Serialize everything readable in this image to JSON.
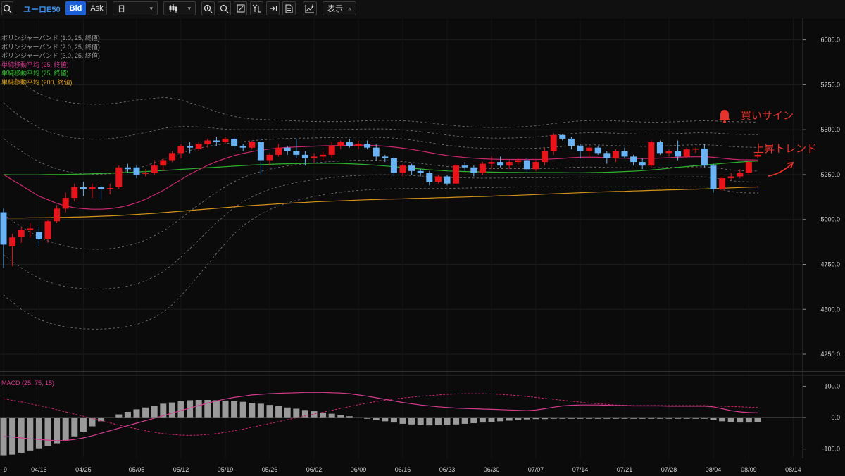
{
  "toolbar": {
    "symbol": "ユーロE50",
    "bid_label": "Bid",
    "ask_label": "Ask",
    "period_value": "日",
    "display_label": "表示"
  },
  "legend": {
    "bb1": "ボリンジャーバンド (1.0, 25, 終値)",
    "bb2": "ボリンジャーバンド (2.0, 25, 終値)",
    "bb3": "ボリンジャーバンド (3.0, 25, 終値)",
    "sma25": "単純移動平均 (25, 終値)",
    "sma75": "単純移動平均 (75, 終値)",
    "sma200": "単純移動平均 (200, 終値)"
  },
  "macd_label": "MACD (25, 75, 15)",
  "annotations": {
    "buy_signal": "買いサイン",
    "uptrend": "上昇トレンド"
  },
  "colors": {
    "up_candle": "#e8141c",
    "down_candle": "#6ab4f5",
    "sma25": "#c8286e",
    "sma75": "#2fb12f",
    "sma200": "#d4921c",
    "annotation": "#e8322c",
    "bid_active": "#1c5fd6"
  },
  "price_axis": {
    "ticks": [
      4250,
      4500,
      4750,
      5000,
      5250,
      5500,
      5750,
      6000
    ],
    "labels": [
      "4250.0",
      "4500.0",
      "4750.0",
      "5000.0",
      "5250.0",
      "5500.0",
      "5750.0",
      "6000.0"
    ]
  },
  "macd_axis": {
    "ticks": [
      -100,
      0,
      100
    ],
    "labels": [
      "-100.0",
      "0.0",
      "100.0"
    ]
  },
  "date_axis": {
    "labels": [
      "9",
      "04/16",
      "04/25",
      "05/05",
      "05/12",
      "05/19",
      "05/26",
      "06/02",
      "06/09",
      "06/16",
      "06/23",
      "06/30",
      "07/07",
      "07/14",
      "07/21",
      "07/28",
      "08/04",
      "08/09",
      "08/14"
    ],
    "index": [
      0,
      4,
      9,
      15,
      20,
      25,
      30,
      35,
      40,
      45,
      50,
      55,
      60,
      65,
      70,
      75,
      80,
      84,
      89
    ]
  },
  "chart_data": {
    "type": "candlestick",
    "candles": [
      [
        5040,
        5060,
        4730,
        4860
      ],
      [
        4850,
        4920,
        4740,
        4900
      ],
      [
        4905,
        4960,
        4870,
        4940
      ],
      [
        4940,
        4980,
        4900,
        4950
      ],
      [
        4930,
        4960,
        4850,
        4890
      ],
      [
        4890,
        5000,
        4870,
        4990
      ],
      [
        4990,
        5080,
        4980,
        5060
      ],
      [
        5060,
        5150,
        5040,
        5120
      ],
      [
        5120,
        5200,
        5100,
        5180
      ],
      [
        5180,
        5210,
        5130,
        5170
      ],
      [
        5170,
        5200,
        5120,
        5180
      ],
      [
        5180,
        5190,
        5110,
        5170
      ],
      [
        5170,
        5200,
        5140,
        5175
      ],
      [
        5180,
        5300,
        5170,
        5290
      ],
      [
        5290,
        5310,
        5260,
        5280
      ],
      [
        5290,
        5300,
        5230,
        5250
      ],
      [
        5260,
        5280,
        5240,
        5260
      ],
      [
        5260,
        5330,
        5250,
        5300
      ],
      [
        5300,
        5340,
        5270,
        5330
      ],
      [
        5330,
        5380,
        5320,
        5370
      ],
      [
        5370,
        5420,
        5340,
        5410
      ],
      [
        5410,
        5430,
        5370,
        5400
      ],
      [
        5395,
        5430,
        5380,
        5420
      ],
      [
        5420,
        5450,
        5400,
        5440
      ],
      [
        5440,
        5460,
        5410,
        5430
      ],
      [
        5430,
        5460,
        5420,
        5450
      ],
      [
        5450,
        5460,
        5390,
        5410
      ],
      [
        5410,
        5420,
        5380,
        5400
      ],
      [
        5400,
        5440,
        5390,
        5430
      ],
      [
        5430,
        5450,
        5250,
        5330
      ],
      [
        5330,
        5370,
        5300,
        5360
      ],
      [
        5360,
        5420,
        5350,
        5400
      ],
      [
        5400,
        5410,
        5360,
        5380
      ],
      [
        5380,
        5450,
        5340,
        5360
      ],
      [
        5360,
        5380,
        5300,
        5340
      ],
      [
        5340,
        5370,
        5310,
        5350
      ],
      [
        5350,
        5380,
        5330,
        5360
      ],
      [
        5360,
        5430,
        5340,
        5410
      ],
      [
        5410,
        5440,
        5390,
        5430
      ],
      [
        5430,
        5450,
        5400,
        5410
      ],
      [
        5410,
        5440,
        5390,
        5420
      ],
      [
        5420,
        5440,
        5390,
        5400
      ],
      [
        5400,
        5420,
        5330,
        5350
      ],
      [
        5350,
        5360,
        5320,
        5340
      ],
      [
        5340,
        5350,
        5240,
        5260
      ],
      [
        5260,
        5310,
        5240,
        5300
      ],
      [
        5300,
        5310,
        5250,
        5270
      ],
      [
        5270,
        5280,
        5240,
        5260
      ],
      [
        5260,
        5270,
        5190,
        5210
      ],
      [
        5210,
        5250,
        5200,
        5240
      ],
      [
        5240,
        5250,
        5190,
        5200
      ],
      [
        5200,
        5310,
        5195,
        5300
      ],
      [
        5300,
        5320,
        5270,
        5290
      ],
      [
        5290,
        5300,
        5240,
        5260
      ],
      [
        5260,
        5320,
        5250,
        5310
      ],
      [
        5310,
        5350,
        5280,
        5320
      ],
      [
        5320,
        5350,
        5290,
        5300
      ],
      [
        5300,
        5330,
        5280,
        5320
      ],
      [
        5320,
        5340,
        5300,
        5330
      ],
      [
        5330,
        5340,
        5260,
        5280
      ],
      [
        5280,
        5330,
        5270,
        5320
      ],
      [
        5320,
        5400,
        5300,
        5380
      ],
      [
        5380,
        5480,
        5360,
        5470
      ],
      [
        5470,
        5475,
        5440,
        5450
      ],
      [
        5450,
        5460,
        5390,
        5410
      ],
      [
        5410,
        5420,
        5340,
        5380
      ],
      [
        5380,
        5410,
        5350,
        5400
      ],
      [
        5400,
        5410,
        5360,
        5370
      ],
      [
        5370,
        5380,
        5310,
        5340
      ],
      [
        5340,
        5390,
        5320,
        5380
      ],
      [
        5380,
        5400,
        5340,
        5350
      ],
      [
        5350,
        5360,
        5300,
        5320
      ],
      [
        5320,
        5340,
        5280,
        5300
      ],
      [
        5300,
        5440,
        5290,
        5430
      ],
      [
        5430,
        5440,
        5360,
        5370
      ],
      [
        5370,
        5390,
        5350,
        5380
      ],
      [
        5380,
        5440,
        5330,
        5350
      ],
      [
        5350,
        5400,
        5340,
        5390
      ],
      [
        5390,
        5400,
        5370,
        5395
      ],
      [
        5395,
        5420,
        5290,
        5300
      ],
      [
        5300,
        5310,
        5150,
        5170
      ],
      [
        5170,
        5240,
        5160,
        5230
      ],
      [
        5230,
        5260,
        5220,
        5240
      ],
      [
        5240,
        5280,
        5230,
        5260
      ],
      [
        5260,
        5330,
        5250,
        5320
      ],
      [
        5350,
        5370,
        5340,
        5360
      ]
    ],
    "sma25": [
      5250,
      5220,
      5190,
      5160,
      5130,
      5110,
      5090,
      5075,
      5065,
      5060,
      5057,
      5057,
      5060,
      5067,
      5078,
      5093,
      5112,
      5137,
      5162,
      5192,
      5222,
      5252,
      5277,
      5302,
      5322,
      5340,
      5356,
      5368,
      5378,
      5386,
      5392,
      5397,
      5401,
      5404,
      5406,
      5408,
      5410,
      5411,
      5412,
      5413,
      5414,
      5413,
      5411,
      5408,
      5403,
      5397,
      5390,
      5382,
      5373,
      5364,
      5356,
      5350,
      5345,
      5341,
      5338,
      5336,
      5335,
      5334,
      5334,
      5334,
      5334,
      5335,
      5337,
      5340,
      5344,
      5346,
      5347,
      5346,
      5344,
      5342,
      5341,
      5340,
      5339,
      5340,
      5342,
      5344,
      5346,
      5348,
      5349,
      5349,
      5346,
      5341,
      5336,
      5333,
      5332,
      5331
    ],
    "sma75": [
      5250,
      5249,
      5249,
      5249,
      5249,
      5250,
      5250,
      5251,
      5252,
      5253,
      5255,
      5256,
      5258,
      5260,
      5262,
      5265,
      5267,
      5270,
      5273,
      5276,
      5279,
      5282,
      5285,
      5288,
      5291,
      5294,
      5297,
      5300,
      5303,
      5305,
      5307,
      5309,
      5310,
      5311,
      5312,
      5313,
      5313,
      5313,
      5312,
      5310,
      5308,
      5305,
      5302,
      5298,
      5294,
      5290,
      5285,
      5281,
      5277,
      5274,
      5271,
      5269,
      5267,
      5266,
      5265,
      5264,
      5263,
      5262,
      5262,
      5261,
      5261,
      5261,
      5261,
      5261,
      5260,
      5260,
      5261,
      5262,
      5263,
      5265,
      5267,
      5269,
      5272,
      5276,
      5280,
      5285,
      5290,
      5295,
      5299,
      5303,
      5307,
      5312,
      5316,
      5320,
      5323,
      5325
    ],
    "sma200": [
      5008,
      5008,
      5008,
      5009,
      5009,
      5010,
      5011,
      5012,
      5013,
      5014,
      5016,
      5018,
      5020,
      5022,
      5025,
      5028,
      5031,
      5034,
      5038,
      5042,
      5046,
      5050,
      5054,
      5058,
      5062,
      5066,
      5070,
      5074,
      5078,
      5081,
      5084,
      5087,
      5090,
      5093,
      5095,
      5098,
      5100,
      5102,
      5104,
      5106,
      5108,
      5110,
      5111,
      5113,
      5114,
      5115,
      5117,
      5118,
      5119,
      5121,
      5122,
      5124,
      5125,
      5127,
      5128,
      5130,
      5132,
      5133,
      5135,
      5137,
      5139,
      5141,
      5143,
      5145,
      5147,
      5149,
      5151,
      5153,
      5154,
      5156,
      5157,
      5159,
      5160,
      5162,
      5163,
      5165,
      5166,
      5168,
      5169,
      5170,
      5172,
      5174,
      5176,
      5178,
      5180,
      5181
    ],
    "bb_upper3": [
      5850,
      5800,
      5760,
      5730,
      5700,
      5680,
      5665,
      5655,
      5648,
      5644,
      5642,
      5642,
      5645,
      5650,
      5657,
      5665,
      5670,
      5675,
      5680,
      5675,
      5665,
      5650,
      5635,
      5618,
      5600,
      5585,
      5573,
      5565,
      5560,
      5557,
      5555,
      5553,
      5551,
      5549,
      5547,
      5546,
      5545,
      5545,
      5545,
      5546,
      5548,
      5550,
      5551,
      5552,
      5551,
      5550,
      5547,
      5543,
      5538,
      5532,
      5527,
      5522,
      5518,
      5515,
      5513,
      5512,
      5512,
      5513,
      5515,
      5518,
      5522,
      5528,
      5534,
      5540,
      5545,
      5549,
      5551,
      5552,
      5551,
      5549,
      5547,
      5545,
      5543,
      5542,
      5542,
      5543,
      5545,
      5547,
      5549,
      5550,
      5549,
      5547,
      5545,
      5544,
      5543,
      5542
    ],
    "bb_lower3": [
      4580,
      4540,
      4500,
      4470,
      4445,
      4425,
      4412,
      4402,
      4396,
      4392,
      4390,
      4390,
      4393,
      4398,
      4405,
      4415,
      4432,
      4455,
      4485,
      4525,
      4575,
      4630,
      4690,
      4750,
      4810,
      4868,
      4920,
      4965,
      5000,
      5030,
      5055,
      5075,
      5092,
      5106,
      5118,
      5128,
      5137,
      5145,
      5152,
      5158,
      5162,
      5165,
      5168,
      5170,
      5171,
      5172,
      5172,
      5172,
      5172,
      5172,
      5173,
      5174,
      5175,
      5176,
      5177,
      5178,
      5179,
      5180,
      5181,
      5182,
      5182,
      5182,
      5182,
      5182,
      5182,
      5182,
      5182,
      5182,
      5182,
      5182,
      5182,
      5182,
      5182,
      5182,
      5182,
      5182,
      5182,
      5182,
      5182,
      5182,
      5176,
      5166,
      5156,
      5150,
      5148,
      5148
    ],
    "macd": [
      -60,
      -62,
      -65,
      -68,
      -70,
      -72,
      -74,
      -73,
      -70,
      -65,
      -58,
      -50,
      -42,
      -34,
      -26,
      -18,
      -10,
      -2,
      6,
      14,
      22,
      30,
      38,
      46,
      53,
      59,
      64,
      68,
      72,
      74,
      76,
      77,
      78,
      79,
      80,
      80,
      80,
      79,
      78,
      76,
      72,
      68,
      63,
      58,
      53,
      48,
      44,
      40,
      37,
      34,
      32,
      30,
      29,
      28,
      27,
      26,
      25,
      24,
      23,
      22,
      24,
      28,
      33,
      37,
      39,
      40,
      40,
      40,
      39,
      38,
      38,
      37,
      37,
      37,
      37,
      36,
      36,
      36,
      36,
      36,
      34,
      28,
      22,
      18,
      16,
      15
    ],
    "signal": [
      60,
      55,
      50,
      44,
      38,
      32,
      25,
      18,
      11,
      4,
      -3,
      -10,
      -17,
      -24,
      -30,
      -36,
      -42,
      -47,
      -51,
      -54,
      -56,
      -57,
      -56,
      -54,
      -51,
      -47,
      -42,
      -37,
      -31,
      -25,
      -19,
      -13,
      -7,
      -1,
      5,
      11,
      17,
      23,
      29,
      35,
      41,
      46,
      51,
      55,
      59,
      62,
      65,
      68,
      70,
      72,
      74,
      75,
      76,
      76,
      76,
      75,
      74,
      72,
      70,
      67,
      64,
      61,
      58,
      55,
      52,
      49,
      46,
      44,
      42,
      40,
      39,
      38,
      38,
      38,
      38,
      38,
      38,
      38,
      38,
      38,
      37,
      36,
      35,
      34,
      33,
      32
    ],
    "histogram": [
      -120,
      -118,
      -112,
      -105,
      -98,
      -90,
      -82,
      -72,
      -60,
      -45,
      -28,
      -12,
      0,
      10,
      18,
      26,
      32,
      38,
      44,
      48,
      52,
      55,
      56,
      56,
      55,
      54,
      52,
      50,
      47,
      44,
      40,
      36,
      32,
      28,
      24,
      20,
      16,
      12,
      8,
      4,
      0,
      -4,
      -8,
      -12,
      -16,
      -20,
      -22,
      -24,
      -25,
      -24,
      -23,
      -22,
      -20,
      -18,
      -16,
      -14,
      -12,
      -10,
      -8,
      -6,
      -5,
      -5,
      -4,
      -4,
      -4,
      -4,
      -4,
      -4,
      -4,
      -4,
      -4,
      -4,
      -4,
      -4,
      -4,
      -4,
      -4,
      -4,
      -4,
      -4,
      -8,
      -12,
      -14,
      -16,
      -16,
      -15
    ],
    "price_range": [
      4160,
      6120
    ],
    "macd_range": [
      -130,
      130
    ]
  }
}
